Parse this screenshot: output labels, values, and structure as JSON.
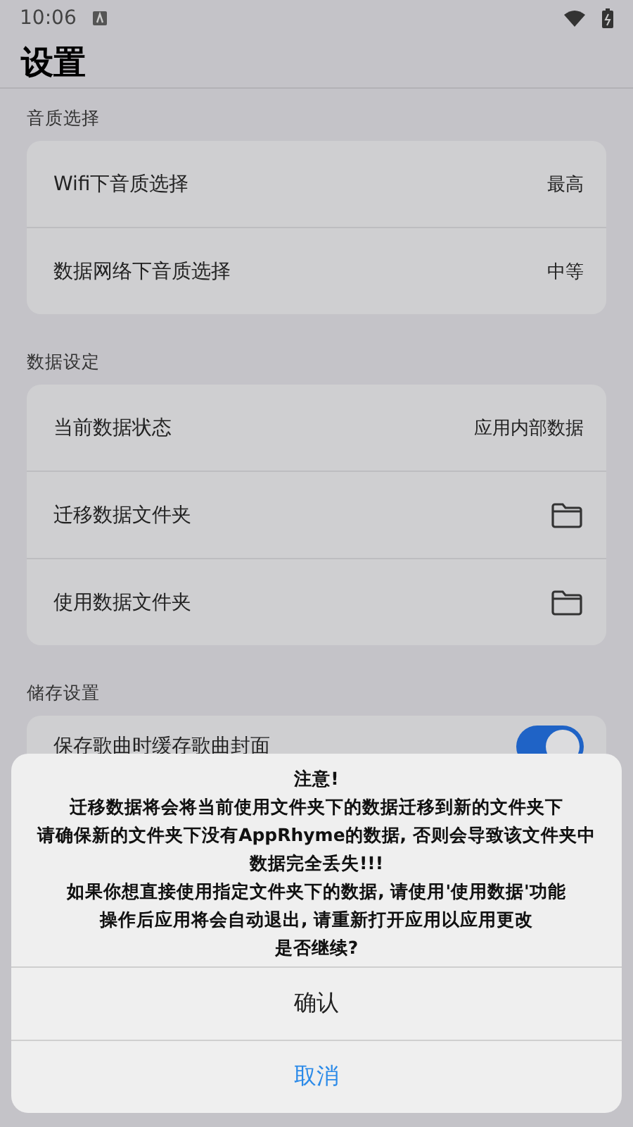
{
  "status_bar": {
    "time": "10:06"
  },
  "title": "设置",
  "sections": [
    {
      "label": "音质选择",
      "rows": [
        {
          "kind": "value",
          "label": "Wifi下音质选择",
          "value": "最高"
        },
        {
          "kind": "value",
          "label": "数据网络下音质选择",
          "value": "中等"
        }
      ]
    },
    {
      "label": "数据设定",
      "rows": [
        {
          "kind": "value",
          "label": "当前数据状态",
          "value": "应用内部数据"
        },
        {
          "kind": "folder",
          "label": "迁移数据文件夹"
        },
        {
          "kind": "folder",
          "label": "使用数据文件夹"
        }
      ]
    },
    {
      "label": "储存设置",
      "rows": [
        {
          "kind": "switch",
          "label": "保存歌曲时缓存歌曲封面",
          "on": true
        }
      ]
    }
  ],
  "dialog": {
    "message": [
      "注意!",
      "迁移数据将会将当前使用文件夹下的数据迁移到新的文件夹下",
      "请确保新的文件夹下没有AppRhyme的数据, 否则会导致该文件夹中数据完全丢失!!!",
      "如果你想直接使用指定文件夹下的数据, 请使用'使用数据'功能",
      "操作后应用将会自动退出, 请重新打开应用以应用更改",
      "是否继续?"
    ],
    "buttons": [
      {
        "label": "确认",
        "kind": "default"
      },
      {
        "label": "取消",
        "kind": "cancel"
      }
    ]
  }
}
